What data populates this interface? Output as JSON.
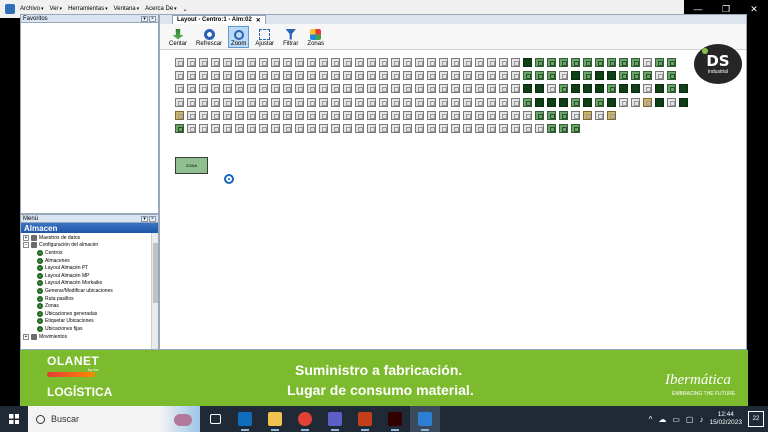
{
  "menubar": {
    "items": [
      "Archivo",
      "Ver",
      "Herramientas",
      "Ventana",
      "Acerca De"
    ],
    "overflow": "⌄"
  },
  "window_controls": {
    "minimize": "—",
    "maximize": "❐",
    "close": "✕"
  },
  "favorites": {
    "title": "Favoritos"
  },
  "menu_pane": {
    "title": "Menú",
    "header": "Almacen",
    "tree": [
      {
        "label": "Maestros de datos",
        "level": 0,
        "expander": "+"
      },
      {
        "label": "Configuración del almacén",
        "level": 0,
        "expander": "−"
      },
      {
        "label": "Centros",
        "level": 1
      },
      {
        "label": "Almacenes",
        "level": 1
      },
      {
        "label": "Layout Almacén PT",
        "level": 1
      },
      {
        "label": "Layout Almacén MP",
        "level": 1
      },
      {
        "label": "Layout Almacén Morkaiko",
        "level": 1
      },
      {
        "label": "Generar/Modificar ubicaciones",
        "level": 1
      },
      {
        "label": "Ruta pasillos",
        "level": 1
      },
      {
        "label": "Zonas",
        "level": 1
      },
      {
        "label": "Ubicaciones generadas",
        "level": 1
      },
      {
        "label": "Etiquetar Ubicaciones",
        "level": 1
      },
      {
        "label": "Ubicaciones fijas",
        "level": 1
      },
      {
        "label": "Movimientos",
        "level": 0,
        "expander": "+"
      }
    ]
  },
  "main": {
    "tab_label": "Layout - Centro:1 - Alm:02",
    "tab_close": "✕",
    "toolbar": [
      {
        "label": "Centar",
        "icon": "center-icon",
        "active": false
      },
      {
        "label": "Refrescar",
        "icon": "refresh-icon",
        "active": false
      },
      {
        "label": "Zoom",
        "icon": "zoom-icon",
        "active": true
      },
      {
        "label": "Ajustar",
        "icon": "fit-icon",
        "active": false
      },
      {
        "label": "Filtrar",
        "icon": "filter-icon",
        "active": false
      },
      {
        "label": "Zonas",
        "icon": "zones-icon",
        "active": false
      }
    ],
    "zone_block_label": "ZONA",
    "rows": [
      "wwwwwwwwwwwwwwwwwwwwwwwwwwwwwdgggggggggwgg",
      "wwwwwwwwwwwwwwwwwwwwwwwwwwwwwgggwdgddgggwg",
      "wwwwwwwwwwwwwwwwwwwwwwwwwwwwwddwgdddgddwdgd",
      "wwwwwwwwwwwwwwwwwwwwwwwwwwwwwgdddgdgdwwydwd",
      "ywwwwwwwwwwwwwwwwwwwwwwwwwwwwwgggwywy",
      "gwwwwwwwwwwwwwwwwwwwwwwwwwwwwwwggg"
    ]
  },
  "ds_logo": {
    "big": "DS",
    "small": "industrial"
  },
  "banner": {
    "olanet": "OLANET",
    "olanet_sub": "by ibx",
    "logistica": "LOGÍSTICA",
    "line1": "Suministro a fabricación.",
    "line2": "Lugar de consumo material.",
    "ibermatica": "Ibermática",
    "ibermatica_sub": "EMBRACING THE FUTURE"
  },
  "taskbar": {
    "search_placeholder": "Buscar",
    "apps": [
      {
        "name": "task-view",
        "color": "#ffffff"
      },
      {
        "name": "outlook",
        "color": "#0f6cbd"
      },
      {
        "name": "file-explorer",
        "color": "#f2c14e"
      },
      {
        "name": "chrome",
        "color": "#e34133"
      },
      {
        "name": "teams",
        "color": "#5b5fc7"
      },
      {
        "name": "powerpoint",
        "color": "#c43e1c"
      },
      {
        "name": "illustrator",
        "color": "#330000"
      },
      {
        "name": "media-player",
        "color": "#2d7fd3"
      }
    ],
    "time": "12:44",
    "date": "15/02/2023",
    "notifications": "22"
  }
}
